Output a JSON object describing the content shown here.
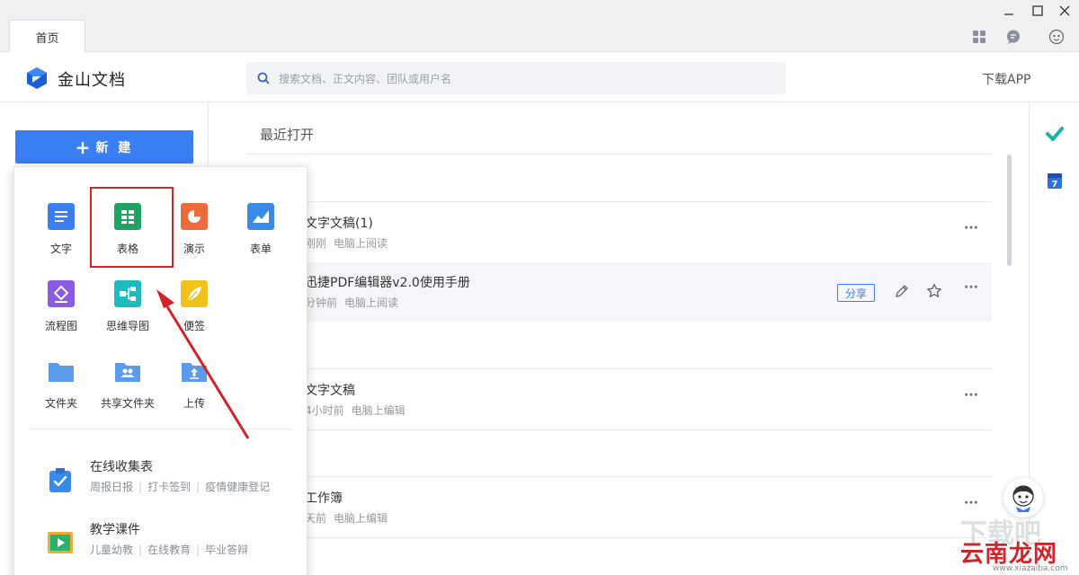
{
  "tabs": [
    {
      "label": "首页"
    }
  ],
  "header": {
    "brand": "金山文档",
    "search_placeholder": "搜索文档、正文内容、团队或用户名",
    "download": "下载APP"
  },
  "sidebar": {
    "new_button": "新 建"
  },
  "new_menu": {
    "tiles": [
      {
        "label": "文字",
        "icon": "doc-icon",
        "color": "#3a7ef3"
      },
      {
        "label": "表格",
        "icon": "sheet-icon",
        "color": "#1fa363"
      },
      {
        "label": "演示",
        "icon": "slides-icon",
        "color": "#ee6a3c"
      },
      {
        "label": "表单",
        "icon": "form-icon",
        "color": "#3a8ae8"
      },
      {
        "label": "流程图",
        "icon": "flowchart-icon",
        "color": "#8a5be2"
      },
      {
        "label": "思维导图",
        "icon": "mindmap-icon",
        "color": "#1ebac0"
      },
      {
        "label": "便签",
        "icon": "note-icon",
        "color": "#f2c21b"
      },
      {
        "label": "文件夹",
        "icon": "folder-icon",
        "color": "#5b9bea"
      },
      {
        "label": "共享文件夹",
        "icon": "shared-folder-icon",
        "color": "#5b9bea"
      },
      {
        "label": "上传",
        "icon": "upload-icon",
        "color": "#5b9bea"
      }
    ],
    "features": [
      {
        "title": "在线收集表",
        "links": [
          "周报日报",
          "打卡签到",
          "疫情健康登记"
        ],
        "icon": "clipboard-icon"
      },
      {
        "title": "教学课件",
        "links": [
          "儿童幼教",
          "在线教育",
          "毕业答辩"
        ],
        "icon": "courseware-icon"
      }
    ]
  },
  "main": {
    "title": "最近打开",
    "files": [
      {
        "name": "文字文稿(1)",
        "time": "刚刚",
        "action": "电脑上阅读"
      },
      {
        "name": "迅捷PDF编辑器v2.0使用手册",
        "time": "分钟前",
        "action": "电脑上阅读",
        "share": "分享"
      },
      {
        "name": "文字文稿",
        "time": "4小时前",
        "action": "电脑上编辑"
      },
      {
        "name": "工作簿",
        "time": "天前",
        "action": "电脑上编辑"
      }
    ],
    "more": "···"
  },
  "watermark": {
    "text": "云南龙网",
    "url": "www.xiazaiba.com"
  },
  "colors": {
    "accent": "#3a7ef3",
    "highlight": "#d0242a"
  }
}
